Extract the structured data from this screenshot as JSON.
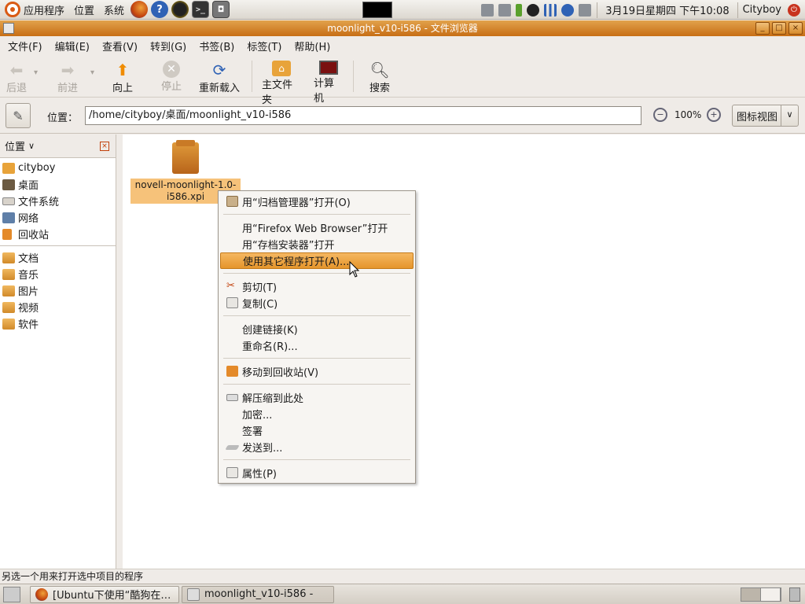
{
  "topbar": {
    "apps_label": "应用程序",
    "places_label": "位置",
    "system_label": "系统",
    "launchers": [
      "firefox-icon",
      "help-icon",
      "qq-icon",
      "terminal-icon",
      "screenshot-icon"
    ],
    "datetime": "3月19日星期四 下午10:08",
    "user": "Cityboy"
  },
  "window": {
    "title": "moonlight_v10-i586 - 文件浏览器"
  },
  "menubar": [
    "文件(F)",
    "编辑(E)",
    "查看(V)",
    "转到(G)",
    "书签(B)",
    "标签(T)",
    "帮助(H)"
  ],
  "toolbar": {
    "back": "后退",
    "forward": "前进",
    "up": "向上",
    "stop": "停止",
    "reload": "重新载入",
    "home": "主文件夹",
    "computer": "计算机",
    "search": "搜索"
  },
  "location": {
    "label": "位置：",
    "path": "/home/cityboy/桌面/moonlight_v10-i586",
    "zoom": "100%",
    "view": "图标视图"
  },
  "sidebar": {
    "header": "位置",
    "places": [
      "cityboy",
      "桌面",
      "文件系统",
      "网络",
      "回收站"
    ],
    "bookmarks": [
      "文档",
      "音乐",
      "图片",
      "视频",
      "软件"
    ]
  },
  "file": {
    "name_line1": "novell-moonlight-1.0-",
    "name_line2": "i586.xpi"
  },
  "context_menu": {
    "open_archive": "用“归档管理器”打开(O)",
    "open_firefox": "用“Firefox Web Browser”打开",
    "open_installer": "用“存档安装器”打开",
    "open_other": "使用其它程序打开(A)...",
    "cut": "剪切(T)",
    "copy": "复制(C)",
    "link": "创建链接(K)",
    "rename": "重命名(R)...",
    "trash": "移动到回收站(V)",
    "extract": "解压缩到此处",
    "encrypt": "加密...",
    "sign": "签署",
    "send": "发送到...",
    "properties": "属性(P)"
  },
  "status": "另选一个用来打开选中项目的程序",
  "taskbar": {
    "task1": "[Ubuntu下使用“酷狗在…",
    "task2": "moonlight_v10-i586 -"
  },
  "colors": {
    "accent": "#e5952b",
    "titlebar": "#c76e15",
    "selection": "#f6c27a"
  }
}
